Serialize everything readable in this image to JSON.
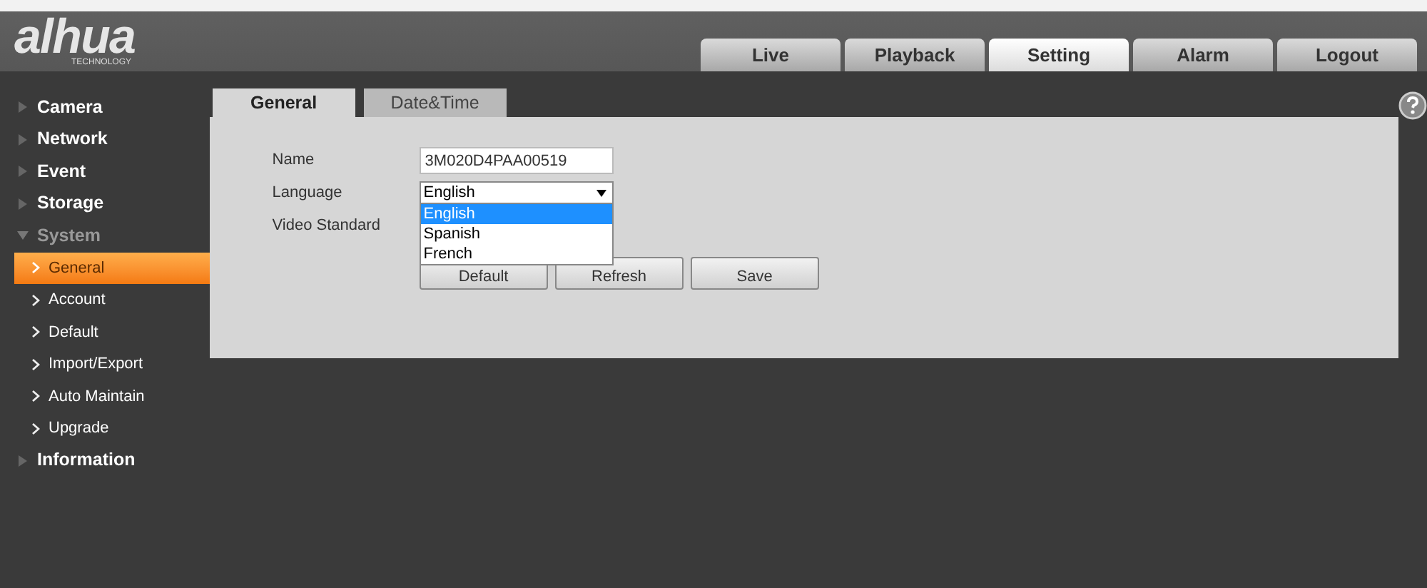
{
  "logo": {
    "wordmark": "alhua",
    "tagline": "TECHNOLOGY"
  },
  "nav_tabs": [
    {
      "label": "Live",
      "selected": false
    },
    {
      "label": "Playback",
      "selected": false
    },
    {
      "label": "Setting",
      "selected": true
    },
    {
      "label": "Alarm",
      "selected": false
    },
    {
      "label": "Logout",
      "selected": false
    }
  ],
  "sidebar": {
    "items": [
      {
        "label": "Camera",
        "expanded": false
      },
      {
        "label": "Network",
        "expanded": false
      },
      {
        "label": "Event",
        "expanded": false
      },
      {
        "label": "Storage",
        "expanded": false
      },
      {
        "label": "System",
        "expanded": true,
        "children": [
          {
            "label": "General",
            "selected": true
          },
          {
            "label": "Account",
            "selected": false
          },
          {
            "label": "Default",
            "selected": false
          },
          {
            "label": "Import/Export",
            "selected": false
          },
          {
            "label": "Auto Maintain",
            "selected": false
          },
          {
            "label": "Upgrade",
            "selected": false
          }
        ]
      },
      {
        "label": "Information",
        "expanded": false
      }
    ]
  },
  "content_tabs": [
    {
      "label": "General",
      "selected": true
    },
    {
      "label": "Date&Time",
      "selected": false
    }
  ],
  "form": {
    "name_label": "Name",
    "name_value": "3M020D4PAA00519",
    "language_label": "Language",
    "language_value": "English",
    "language_options": [
      {
        "label": "English",
        "selected": true
      },
      {
        "label": "Spanish",
        "selected": false
      },
      {
        "label": "French",
        "selected": false
      }
    ],
    "video_standard_label": "Video Standard"
  },
  "buttons": [
    "Default",
    "Refresh",
    "Save"
  ]
}
